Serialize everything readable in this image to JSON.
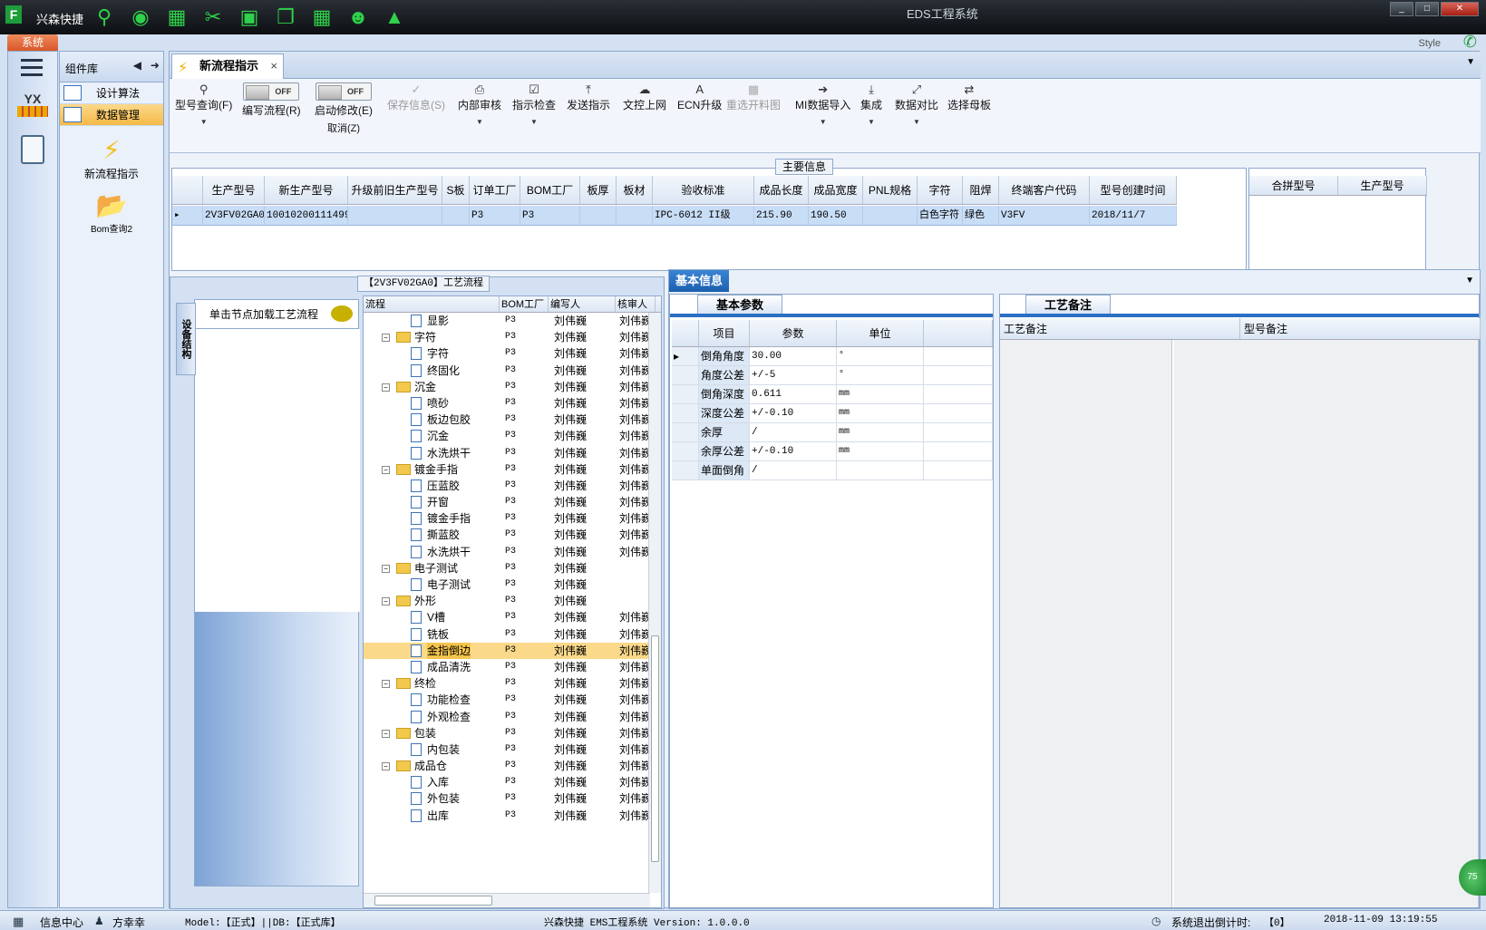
{
  "window": {
    "app_name": "兴森快捷",
    "title": "EDS工程系统",
    "system_tab": "系统",
    "style_label": "Style"
  },
  "quick_access_icons": [
    "search-icon",
    "lifebuoy-icon",
    "grid-icon",
    "scissors-icon",
    "film-icon",
    "copy-icon",
    "grid-icon",
    "user-icon",
    "chart-icon"
  ],
  "component_library": {
    "title": "组件库",
    "items": [
      {
        "label": "设计算法"
      },
      {
        "label": "数据管理",
        "active": true
      }
    ],
    "big_items": [
      {
        "label": "新流程指示",
        "icon": "lightning-icon"
      },
      {
        "label": "Bom查询2",
        "icon": "folder-open-icon"
      }
    ]
  },
  "doc_tab": {
    "label": "新流程指示",
    "close": "×"
  },
  "ribbon": {
    "model_query": "型号查询(F)",
    "edit_flow": "编写流程(R)",
    "start_modify": "启动修改(E)",
    "cancel": "取消(Z)",
    "toggle_off": "OFF",
    "save_info": "保存信息(S)",
    "internal_review": "内部审核",
    "instruction_check": "指示检查",
    "send_instruction": "发送指示",
    "doc_upload": "文控上网",
    "ecn_upgrade": "ECN升级",
    "reselect_cutting": "重选开料图",
    "mi_import": "MI数据导入",
    "integration": "集成",
    "data_compare": "数据对比",
    "select_master": "选择母板"
  },
  "main_info": {
    "title": "主要信息",
    "columns": [
      "生产型号",
      "新生产型号",
      "升级前旧生产型号",
      "S板",
      "订单工厂",
      "BOM工厂",
      "板厚",
      "板材",
      "验收标准",
      "成品长度",
      "成品宽度",
      "PNL规格",
      "字符",
      "阻焊",
      "终端客户代码",
      "型号创建时间"
    ],
    "row": [
      "2V3FV02GA0",
      "10010200111499",
      "",
      "",
      "P3",
      "P3",
      "",
      "",
      "IPC-6012 II级",
      "215.90",
      "190.50",
      "",
      "白色字符",
      "绿色",
      "V3FV",
      "2018/11/7"
    ],
    "side_columns": [
      "合拼型号",
      "生产型号"
    ]
  },
  "process_panel": {
    "title": "【2V3FV02GA0】工艺流程",
    "vertical_tab": "设备结构",
    "hint": "单击节点加载工艺流程",
    "columns": [
      "流程",
      "BOM工厂",
      "编写人",
      "核审人"
    ],
    "rows": [
      {
        "name": "显影",
        "level": 2,
        "bom": "P3",
        "writer": "刘伟巍",
        "reviewer": "刘伟巍"
      },
      {
        "name": "字符",
        "level": 1,
        "bom": "P3",
        "writer": "刘伟巍",
        "reviewer": "刘伟巍"
      },
      {
        "name": "字符",
        "level": 2,
        "bom": "P3",
        "writer": "刘伟巍",
        "reviewer": "刘伟巍"
      },
      {
        "name": "终固化",
        "level": 2,
        "bom": "P3",
        "writer": "刘伟巍",
        "reviewer": "刘伟巍"
      },
      {
        "name": "沉金",
        "level": 1,
        "bom": "P3",
        "writer": "刘伟巍",
        "reviewer": "刘伟巍"
      },
      {
        "name": "喷砂",
        "level": 2,
        "bom": "P3",
        "writer": "刘伟巍",
        "reviewer": "刘伟巍"
      },
      {
        "name": "板边包胶",
        "level": 2,
        "bom": "P3",
        "writer": "刘伟巍",
        "reviewer": "刘伟巍"
      },
      {
        "name": "沉金",
        "level": 2,
        "bom": "P3",
        "writer": "刘伟巍",
        "reviewer": "刘伟巍"
      },
      {
        "name": "水洗烘干",
        "level": 2,
        "bom": "P3",
        "writer": "刘伟巍",
        "reviewer": "刘伟巍"
      },
      {
        "name": "镀金手指",
        "level": 1,
        "bom": "P3",
        "writer": "刘伟巍",
        "reviewer": "刘伟巍"
      },
      {
        "name": "压蓝胶",
        "level": 2,
        "bom": "P3",
        "writer": "刘伟巍",
        "reviewer": "刘伟巍"
      },
      {
        "name": "开窗",
        "level": 2,
        "bom": "P3",
        "writer": "刘伟巍",
        "reviewer": "刘伟巍"
      },
      {
        "name": "镀金手指",
        "level": 2,
        "bom": "P3",
        "writer": "刘伟巍",
        "reviewer": "刘伟巍"
      },
      {
        "name": "撕蓝胶",
        "level": 2,
        "bom": "P3",
        "writer": "刘伟巍",
        "reviewer": "刘伟巍"
      },
      {
        "name": "水洗烘干",
        "level": 2,
        "bom": "P3",
        "writer": "刘伟巍",
        "reviewer": "刘伟巍"
      },
      {
        "name": "电子测试",
        "level": 1,
        "bom": "P3",
        "writer": "刘伟巍",
        "reviewer": ""
      },
      {
        "name": "电子测试",
        "level": 2,
        "bom": "P3",
        "writer": "刘伟巍",
        "reviewer": ""
      },
      {
        "name": "外形",
        "level": 1,
        "bom": "P3",
        "writer": "刘伟巍",
        "reviewer": ""
      },
      {
        "name": "V槽",
        "level": 2,
        "bom": "P3",
        "writer": "刘伟巍",
        "reviewer": "刘伟巍"
      },
      {
        "name": "铣板",
        "level": 2,
        "bom": "P3",
        "writer": "刘伟巍",
        "reviewer": "刘伟巍"
      },
      {
        "name": "金指倒边",
        "level": 2,
        "bom": "P3",
        "writer": "刘伟巍",
        "reviewer": "刘伟巍",
        "selected": true
      },
      {
        "name": "成品清洗",
        "level": 2,
        "bom": "P3",
        "writer": "刘伟巍",
        "reviewer": "刘伟巍"
      },
      {
        "name": "终检",
        "level": 1,
        "bom": "P3",
        "writer": "刘伟巍",
        "reviewer": "刘伟巍"
      },
      {
        "name": "功能检查",
        "level": 2,
        "bom": "P3",
        "writer": "刘伟巍",
        "reviewer": "刘伟巍"
      },
      {
        "name": "外观检查",
        "level": 2,
        "bom": "P3",
        "writer": "刘伟巍",
        "reviewer": "刘伟巍"
      },
      {
        "name": "包装",
        "level": 1,
        "bom": "P3",
        "writer": "刘伟巍",
        "reviewer": "刘伟巍"
      },
      {
        "name": "内包装",
        "level": 2,
        "bom": "P3",
        "writer": "刘伟巍",
        "reviewer": "刘伟巍"
      },
      {
        "name": "成品仓",
        "level": 1,
        "bom": "P3",
        "writer": "刘伟巍",
        "reviewer": "刘伟巍"
      },
      {
        "name": "入库",
        "level": 2,
        "bom": "P3",
        "writer": "刘伟巍",
        "reviewer": "刘伟巍"
      },
      {
        "name": "外包装",
        "level": 2,
        "bom": "P3",
        "writer": "刘伟巍",
        "reviewer": "刘伟巍"
      },
      {
        "name": "出库",
        "level": 2,
        "bom": "P3",
        "writer": "刘伟巍",
        "reviewer": "刘伟巍"
      }
    ]
  },
  "basic_info": {
    "tab": "基本信息",
    "params_tab": "基本参数",
    "notes_tab": "工艺备注",
    "param_columns": [
      "项目",
      "参数",
      "单位"
    ],
    "params": [
      {
        "item": "倒角角度",
        "value": "30.00",
        "unit": "°"
      },
      {
        "item": "角度公差",
        "value": "+/-5",
        "unit": "°"
      },
      {
        "item": "倒角深度",
        "value": "0.611",
        "unit": "mm"
      },
      {
        "item": "深度公差",
        "value": "+/-0.10",
        "unit": "mm"
      },
      {
        "item": "余厚",
        "value": "/",
        "unit": "mm"
      },
      {
        "item": "余厚公差",
        "value": "+/-0.10",
        "unit": "mm"
      },
      {
        "item": "单面倒角",
        "value": "/",
        "unit": ""
      }
    ],
    "note_columns": [
      "工艺备注",
      "型号备注"
    ]
  },
  "status": {
    "info_center": "信息中心",
    "user": "方幸幸",
    "model": "Model:【正式】||DB:【正式库】",
    "version": "兴森快捷 EMS工程系统 Version: 1.0.0.0",
    "countdown_label": "系统退出倒计时:",
    "countdown_value": "【0】",
    "datetime": "2018-11-09 13:19:55",
    "float_badge": "75"
  }
}
